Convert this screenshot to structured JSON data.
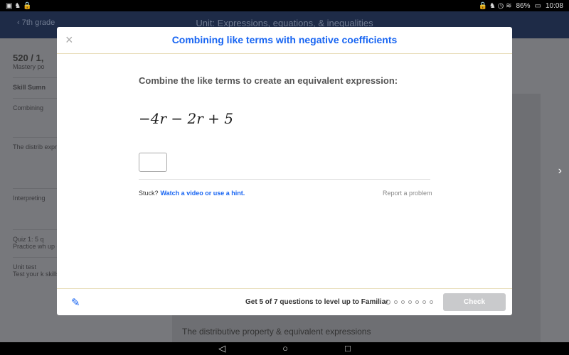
{
  "status_bar": {
    "battery": "86%",
    "time": "10:08"
  },
  "app_bar": {
    "back_label": "7th grade",
    "unit_title": "Unit: Expressions, equations, & inequalities"
  },
  "background": {
    "points": "520 / 1,",
    "mastery": "Mastery po",
    "skill_summary": "Skill Sumn",
    "items": [
      "Combining",
      "The distrib expressions",
      "Interpreting",
      "Quiz 1: 5 q",
      "Practice wh up on the a",
      "Unit test",
      "Test your k skills in this"
    ],
    "section_title": "The distributive property & equivalent expressions"
  },
  "modal": {
    "title": "Combining like terms with negative coefficients",
    "prompt": "Combine the like terms to create an equivalent expression:",
    "expression": "−4r − 2r + 5",
    "answer_value": "",
    "stuck": "Stuck?",
    "hint_link": "Watch a video or use a hint.",
    "report": "Report a problem",
    "progress_text": "Get 5 of 7 questions to level up to Familiar",
    "questions_total": 7,
    "questions_answered": 0,
    "check_label": "Check"
  },
  "colors": {
    "accent": "#1865f2",
    "header": "#1e2b47"
  },
  "nav": {
    "back": "◁",
    "home": "○",
    "recents": "□"
  }
}
